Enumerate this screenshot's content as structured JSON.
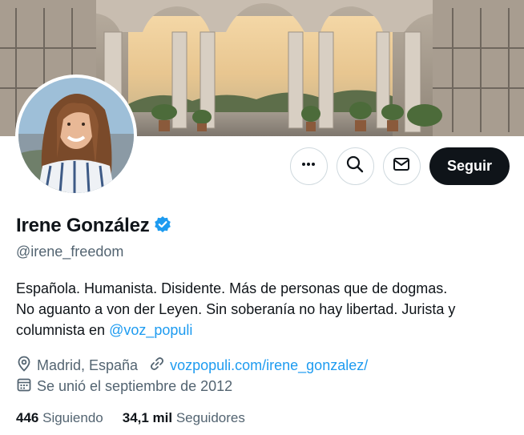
{
  "profile": {
    "name": "Irene González",
    "handle": "@irene_freedom",
    "verified": true,
    "bio": {
      "line1": "Española. Humanista. Disidente. Más de personas que de dogmas.",
      "line2": "No aguanto a von der Leyen. Sin soberanía no hay libertad. Jurista y",
      "line3_text": "columnista en ",
      "line3_mention": "@voz_populi"
    },
    "location": "Madrid, España",
    "website": "vozpopuli.com/irene_gonzalez/",
    "joined": "Se unió el septiembre de 2012",
    "following_count": "446",
    "following_label": "Siguiendo",
    "followers_count": "34,1 mil",
    "followers_label": "Seguidores"
  },
  "actions": {
    "more_icon": "more-horizontal-icon",
    "search_icon": "search-icon",
    "message_icon": "envelope-icon",
    "follow_label": "Seguir"
  },
  "colors": {
    "accent": "#1d9bf0",
    "text": "#0f1419",
    "secondary": "#536471",
    "follow_bg": "#0f1419"
  }
}
